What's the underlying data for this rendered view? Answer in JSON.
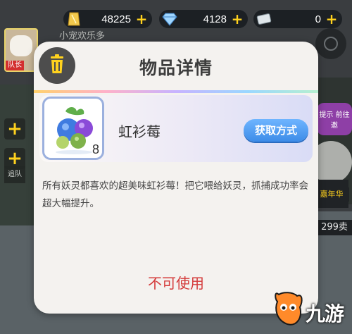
{
  "currencies": [
    {
      "icon": "gold-bar-icon",
      "value": "48225"
    },
    {
      "icon": "diamond-icon",
      "value": "4128"
    },
    {
      "icon": "ticket-icon",
      "value": "0"
    }
  ],
  "background": {
    "team_label": "队长",
    "banner_text": "小宠欢乐多",
    "side_tab": "追队",
    "right_pill": "提示\n前往邀",
    "right_badge": "嘉年华",
    "right_count": "299卖"
  },
  "modal": {
    "title": "物品详情",
    "item": {
      "name": "虹衫莓",
      "count": "8",
      "obtain_label": "获取方式"
    },
    "description": "所有妖灵都喜欢的超美味虹衫莓！把它喂给妖灵，抓捕成功率会超大幅提升。",
    "status": "不可使用"
  },
  "watermark": {
    "text": "九游"
  },
  "colors": {
    "modal_bg": "#f4f2ef",
    "accent_blue": "#3d8ce8",
    "status_red": "#d43a3a",
    "currency_plus": "#ffd21e"
  }
}
